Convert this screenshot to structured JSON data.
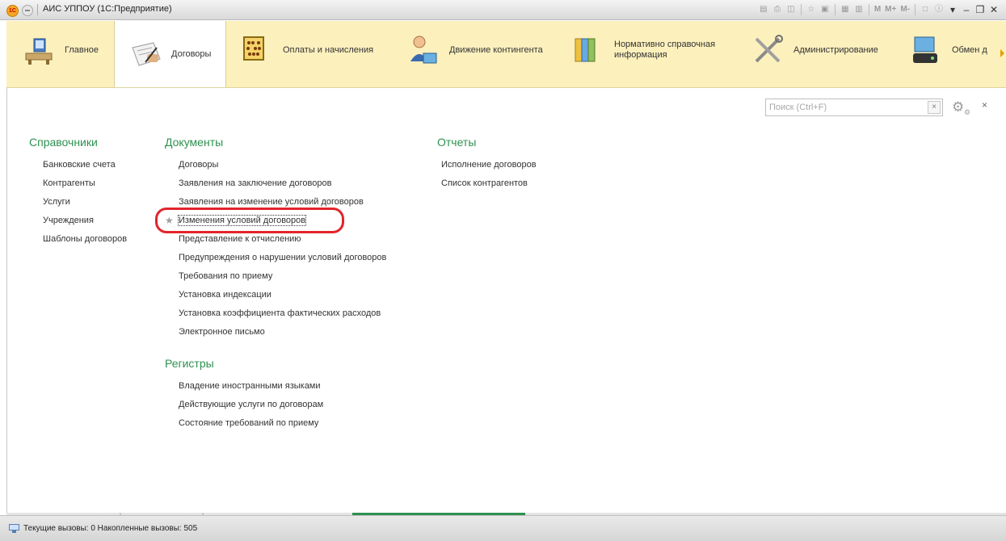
{
  "window": {
    "title": "АИС УППОУ (1С:Предприятие)",
    "logo_text": "1С",
    "toolbar_icons": [
      "save-icon",
      "print-icon",
      "preview-icon",
      "favorite-icon",
      "bookmark-icon",
      "calculator-icon",
      "calendar-icon"
    ],
    "memory_buttons": [
      "M",
      "M+",
      "M-"
    ]
  },
  "sections": [
    {
      "label": "Главное",
      "icon": "home-desk-icon",
      "active": false
    },
    {
      "label": "Договоры",
      "icon": "contract-sign-icon",
      "active": true
    },
    {
      "label": "Оплаты и начисления",
      "icon": "abacus-icon",
      "active": false
    },
    {
      "label": "Движение контингента",
      "icon": "person-icon",
      "active": false
    },
    {
      "label": "Нормативно справочная информация",
      "icon": "binders-icon",
      "active": false
    },
    {
      "label": "Администрирование",
      "icon": "tools-icon",
      "active": false
    },
    {
      "label": "Обмен д",
      "icon": "exchange-icon",
      "active": false
    }
  ],
  "search": {
    "placeholder": "Поиск (Ctrl+F)",
    "clear": "×"
  },
  "panel_close": "×",
  "catalogs": {
    "title": "Справочники",
    "items": [
      "Банковские счета",
      "Контрагенты",
      "Услуги",
      "Учреждения",
      "Шаблоны договоров"
    ]
  },
  "documents": {
    "title": "Документы",
    "items": [
      "Договоры",
      "Заявления на заключение договоров",
      "Заявления на изменение условий договоров",
      "Изменения условий договоров",
      "Представление к отчислению",
      "Предупреждения о нарушении условий договоров",
      "Требования по приему",
      "Установка индексации",
      "Установка коэффициента фактических расходов",
      "Электронное письмо"
    ],
    "selected_item": "Изменения условий договоров"
  },
  "registers": {
    "title": "Регистры",
    "items": [
      "Владение иностранными языками",
      "Действующие услуги по договорам",
      "Состояние требований по приему"
    ]
  },
  "reports": {
    "title": "Отчеты",
    "items": [
      "Исполнение договоров",
      "Список контрагентов"
    ]
  },
  "status": {
    "text": "Текущие вызовы: 0   Накопленные вызовы: 505"
  },
  "colors": {
    "section_bar": "#fcf0bd",
    "group_title": "#2e9150",
    "highlight": "#e1252b",
    "active_tab": "#2e9150"
  }
}
